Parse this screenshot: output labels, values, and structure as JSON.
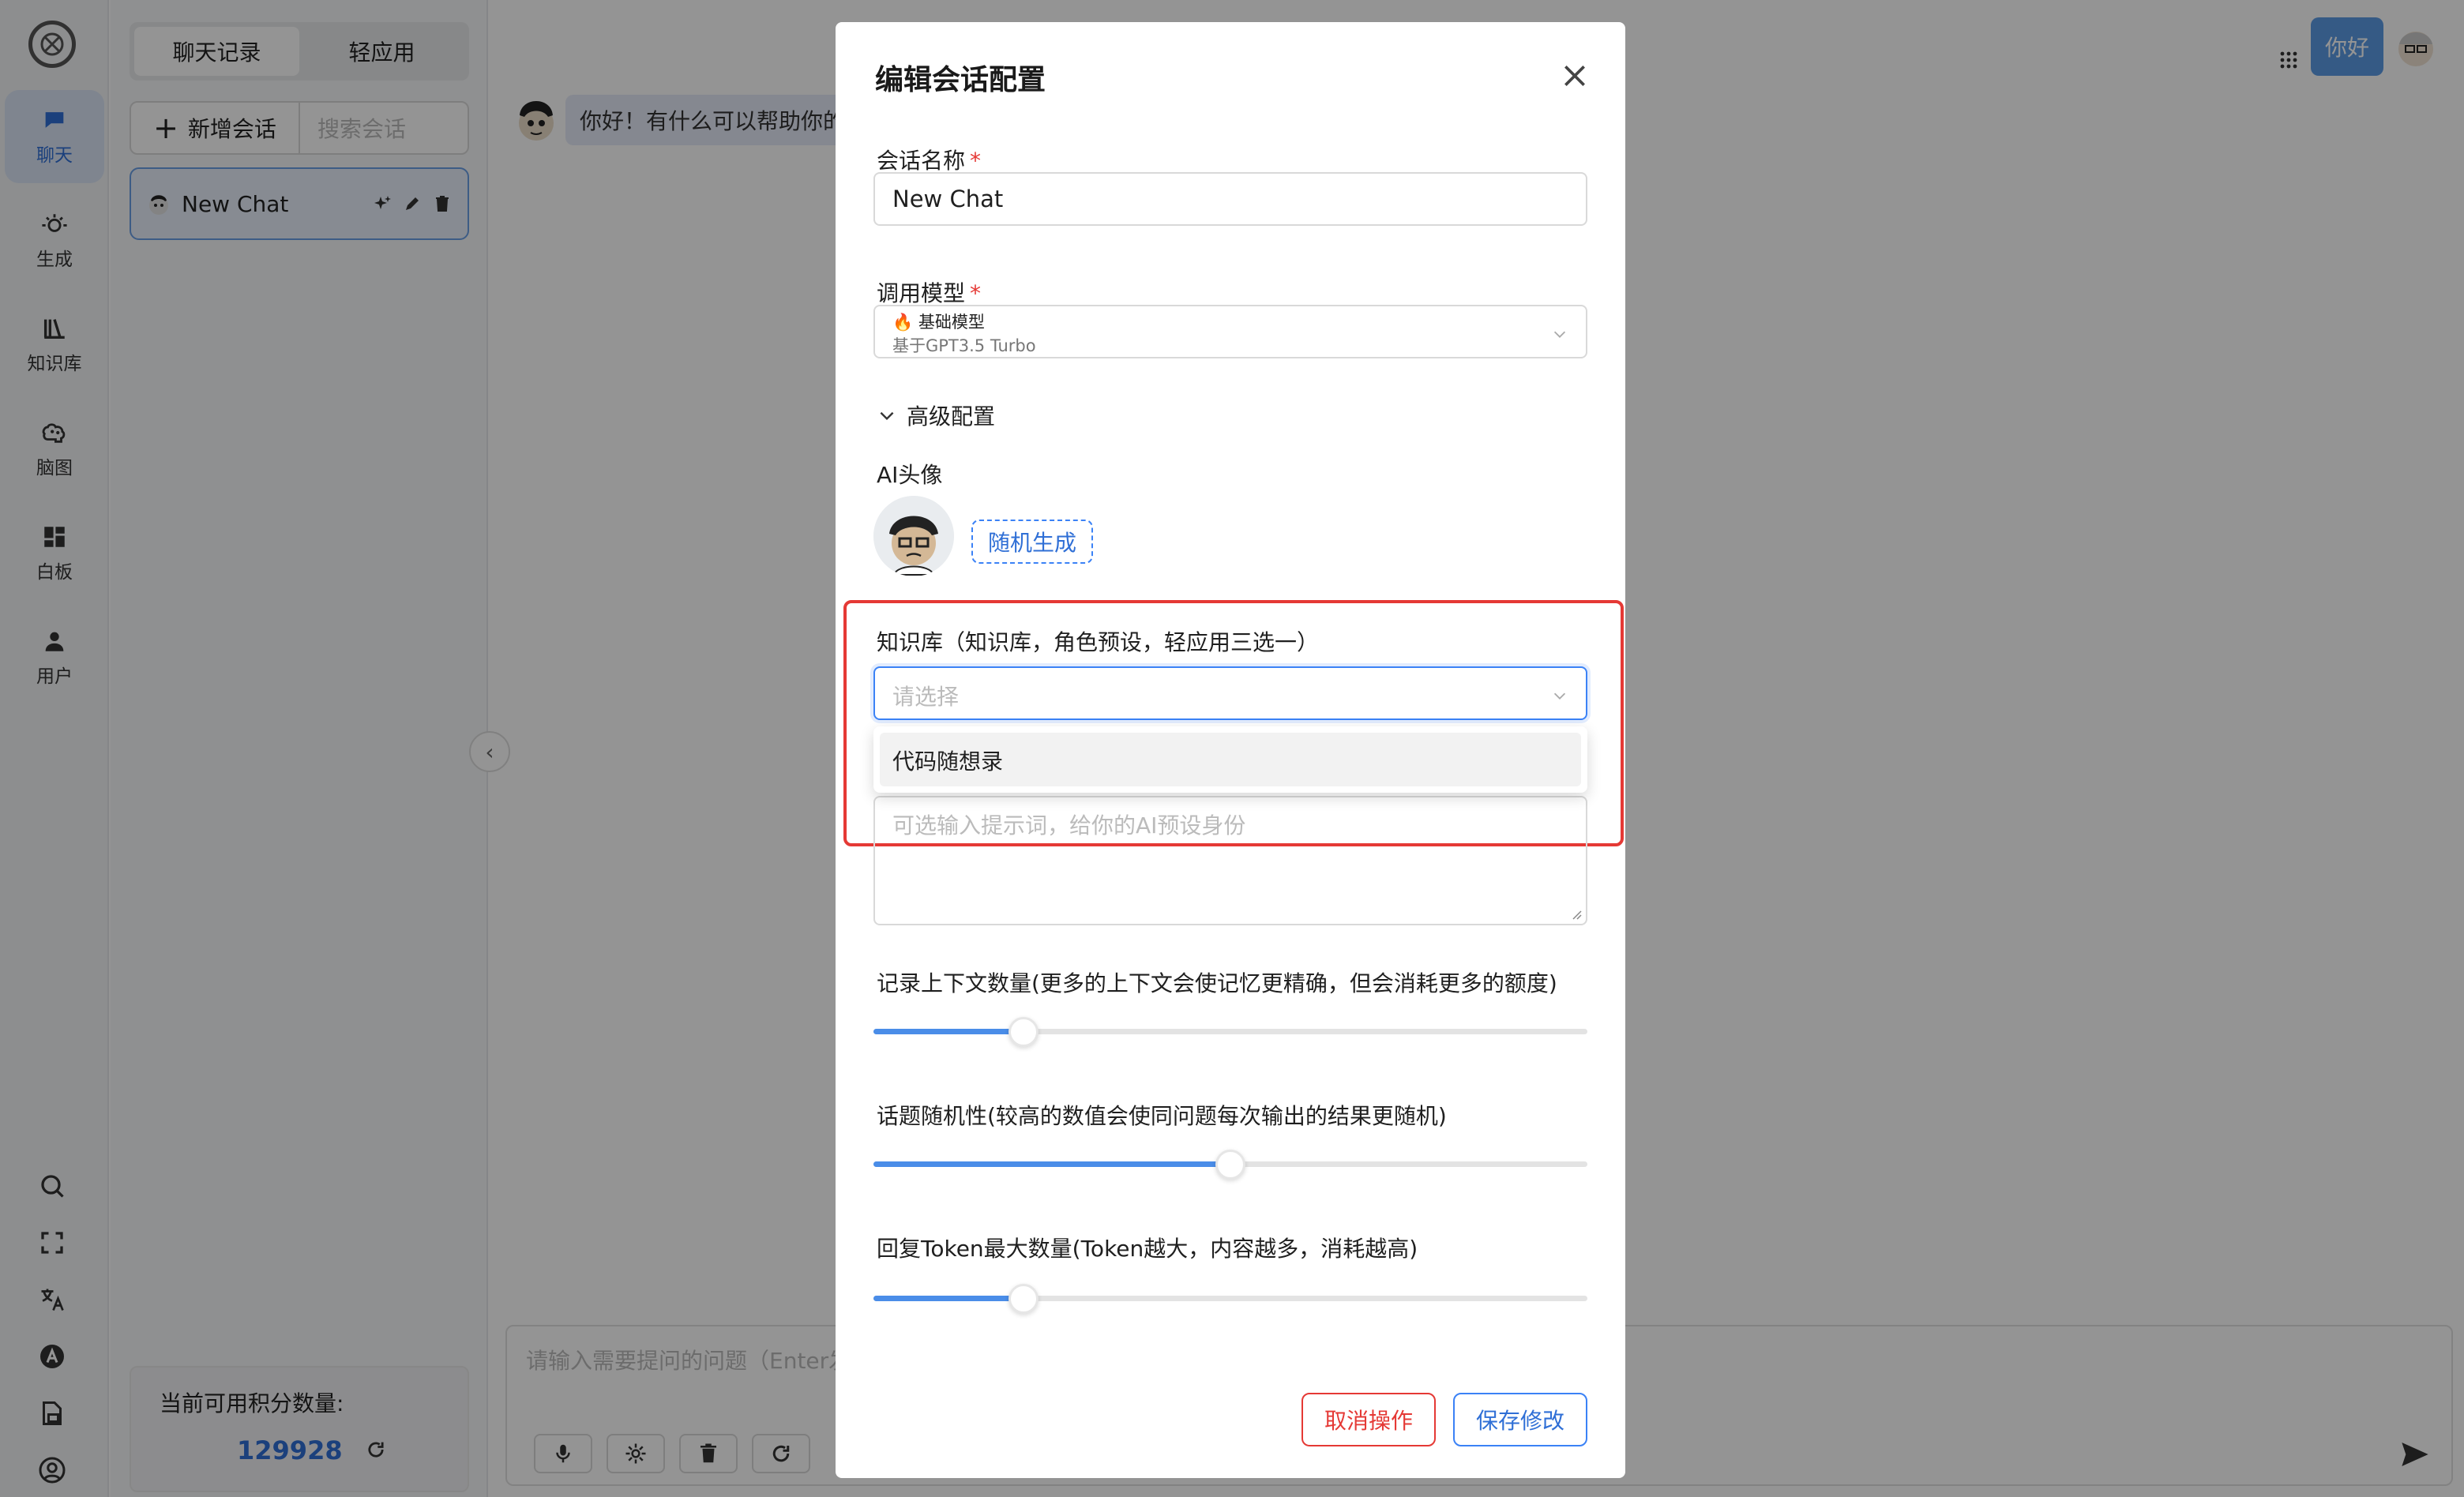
{
  "rail": {
    "items": [
      {
        "label": "聊天",
        "icon": "chat-bubble-icon"
      },
      {
        "label": "生成",
        "icon": "sun-gear-icon"
      },
      {
        "label": "知识库",
        "icon": "library-books-icon"
      },
      {
        "label": "脑图",
        "icon": "brain-icon"
      },
      {
        "label": "白板",
        "icon": "dashboard-icon"
      },
      {
        "label": "用户",
        "icon": "user-icon"
      }
    ],
    "tools": [
      "search-icon",
      "fullscreen-icon",
      "translate-icon",
      "a-circle-icon",
      "document-icon",
      "account-circle-icon"
    ]
  },
  "sidebar": {
    "tabs": [
      "聊天记录",
      "轻应用"
    ],
    "new_chat_label": "新增会话",
    "search_placeholder": "搜索会话",
    "chat_item_title": "New Chat",
    "credits_label": "当前可用积分数量:",
    "credits_value": "129928"
  },
  "main": {
    "greeting": "你好！有什么可以帮助你的",
    "user_message": "你好",
    "input_placeholder": "请输入需要提问的问题（Enter发"
  },
  "modal": {
    "title": "编辑会话配置",
    "name_label": "会话名称",
    "name_value": "New Chat",
    "model_label": "调用模型",
    "model_name": "🔥 基础模型",
    "model_desc": "基于GPT3.5 Turbo",
    "advanced_label": "高级配置",
    "avatar_label": "AI头像",
    "random_button": "随机生成",
    "kb_label": "知识库（知识库，角色预设，轻应用三选一）",
    "kb_placeholder": "请选择",
    "kb_option": "代码随想录",
    "prompt_placeholder": "可选输入提示词，给你的AI预设身份",
    "context_label": "记录上下文数量(更多的上下文会使记忆更精确，但会消耗更多的额度)",
    "randomness_label": "话题随机性(较高的数值会使同问题每次输出的结果更随机)",
    "tokens_label": "回复Token最大数量(Token越大，内容越多，消耗越高)",
    "cancel_label": "取消操作",
    "save_label": "保存修改",
    "context_fraction": 0.21,
    "randomness_fraction": 0.5,
    "tokens_fraction": 0.21
  },
  "colors": {
    "accent": "#3b82f6",
    "danger": "#e53935",
    "active_nav_bg": "#dbe6f7"
  }
}
